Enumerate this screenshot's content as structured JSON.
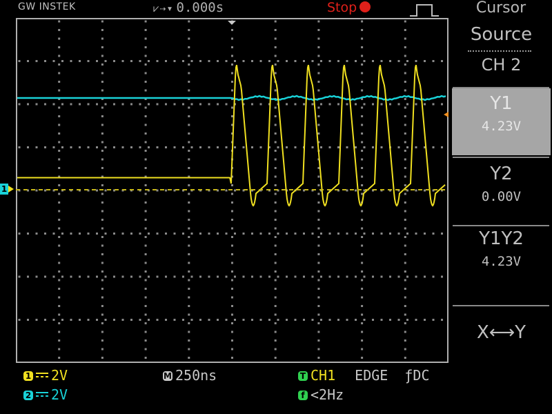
{
  "header": {
    "brand": "GW INSTEK",
    "time_position_arrows": "⩗⇢▾",
    "time_position": "0.000s",
    "run_state": "Stop"
  },
  "menu": {
    "title": "Cursor",
    "source_label": "Source",
    "source_value": "CH 2",
    "y1_label": "Y1",
    "y1_value": "4.23V",
    "y2_label": "Y2",
    "y2_value": "0.00V",
    "y1y2_label": "Y1Y2",
    "y1y2_value": "4.23V",
    "swap_label": "X⟷Y"
  },
  "status": {
    "ch1_badge": "1",
    "ch1_scale": "2V",
    "ch2_badge": "2",
    "ch2_scale": "2V",
    "timebase_badge": "M",
    "timebase": "250ns",
    "trigger_badge": "T",
    "trigger_source": "CH1",
    "trigger_type": "EDGE",
    "trigger_coupling": "ƒDC",
    "freq_badge": "f",
    "frequency": "<2Hz"
  },
  "markers": {
    "ch1_ground": "1"
  },
  "colors": {
    "ch1": "#f0e020",
    "ch2": "#19d2d8",
    "trigger": "#30d050",
    "stop": "#e0201a",
    "grid": "#8a8a8a",
    "cursor": "#c8b818"
  }
}
